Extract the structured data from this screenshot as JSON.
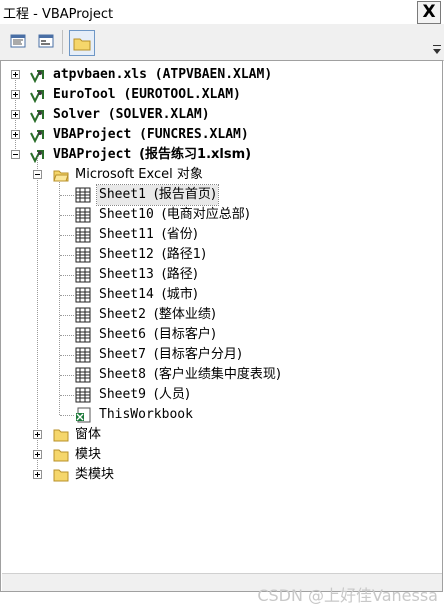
{
  "window": {
    "title": "工程 - VBAProject",
    "close_label": "X"
  },
  "projects": [
    {
      "name": "atpvbaen.xls",
      "detail": "(ATPVBAEN.XLAM)"
    },
    {
      "name": "EuroTool",
      "detail": "(EUROTOOL.XLAM)"
    },
    {
      "name": "Solver",
      "detail": "(SOLVER.XLAM)"
    },
    {
      "name": "VBAProject",
      "detail": "(FUNCRES.XLAM)"
    },
    {
      "name": "VBAProject",
      "detail": "(报告练习1.xlsm)"
    }
  ],
  "excel_objects_folder": "Microsoft Excel 对象",
  "sheets": [
    {
      "name": "Sheet1",
      "caption": "(报告首页)"
    },
    {
      "name": "Sheet10",
      "caption": "(电商对应总部)"
    },
    {
      "name": "Sheet11",
      "caption": "(省份)"
    },
    {
      "name": "Sheet12",
      "caption": "(路径1)"
    },
    {
      "name": "Sheet13",
      "caption": "(路径)"
    },
    {
      "name": "Sheet14",
      "caption": "(城市)"
    },
    {
      "name": "Sheet2",
      "caption": "(整体业绩)"
    },
    {
      "name": "Sheet6",
      "caption": "(目标客户)"
    },
    {
      "name": "Sheet7",
      "caption": "(目标客户分月)"
    },
    {
      "name": "Sheet8",
      "caption": "(客户业绩集中度表现)"
    },
    {
      "name": "Sheet9",
      "caption": "(人员)"
    }
  ],
  "workbook_item": "ThisWorkbook",
  "folders": [
    "窗体",
    "模块",
    "类模块"
  ],
  "watermark": "CSDN @上好佳Vanessa"
}
